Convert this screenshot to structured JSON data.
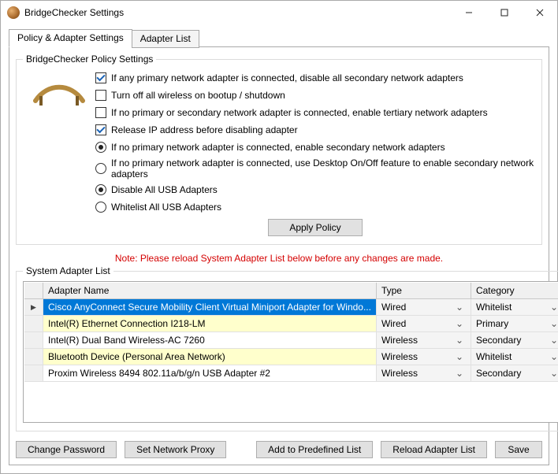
{
  "window": {
    "title": "BridgeChecker Settings"
  },
  "tabs": {
    "active": "Policy & Adapter Settings",
    "inactive": "Adapter List"
  },
  "groups": {
    "policy": "BridgeChecker Policy Settings",
    "system": "System Adapter List"
  },
  "opts": {
    "cb1": "If any primary network adapter is connected, disable all secondary network adapters",
    "cb2": "Turn off all wireless on bootup / shutdown",
    "cb3": "If no primary or secondary network adapter is connected, enable tertiary network adapters",
    "cb4": "Release IP address before disabling adapter",
    "rb1": "If no primary network adapter is connected, enable secondary network adapters",
    "rb2": "If no primary network adapter is connected, use Desktop On/Off feature to enable secondary network adapters",
    "rb3": "Disable All USB Adapters",
    "rb4": "Whitelist All USB Adapters"
  },
  "buttons": {
    "apply": "Apply Policy",
    "changepw": "Change Password",
    "proxy": "Set Network Proxy",
    "addpre": "Add to Predefined List",
    "reload": "Reload Adapter List",
    "save": "Save"
  },
  "note": "Note: Please reload System Adapter List below before any changes are made.",
  "grid": {
    "headers": {
      "name": "Adapter Name",
      "type": "Type",
      "cat": "Category"
    },
    "rows": [
      {
        "name": "Cisco AnyConnect Secure Mobility Client Virtual Miniport Adapter for Windo...",
        "type": "Wired",
        "cat": "Whitelist",
        "sel": true,
        "hl": false
      },
      {
        "name": "Intel(R) Ethernet Connection I218-LM",
        "type": "Wired",
        "cat": "Primary",
        "sel": false,
        "hl": true
      },
      {
        "name": "Intel(R) Dual Band Wireless-AC 7260",
        "type": "Wireless",
        "cat": "Secondary",
        "sel": false,
        "hl": false
      },
      {
        "name": "Bluetooth Device (Personal Area Network)",
        "type": "Wireless",
        "cat": "Whitelist",
        "sel": false,
        "hl": true
      },
      {
        "name": "Proxim Wireless 8494 802.11a/b/g/n USB Adapter #2",
        "type": "Wireless",
        "cat": "Secondary",
        "sel": false,
        "hl": false
      }
    ]
  }
}
